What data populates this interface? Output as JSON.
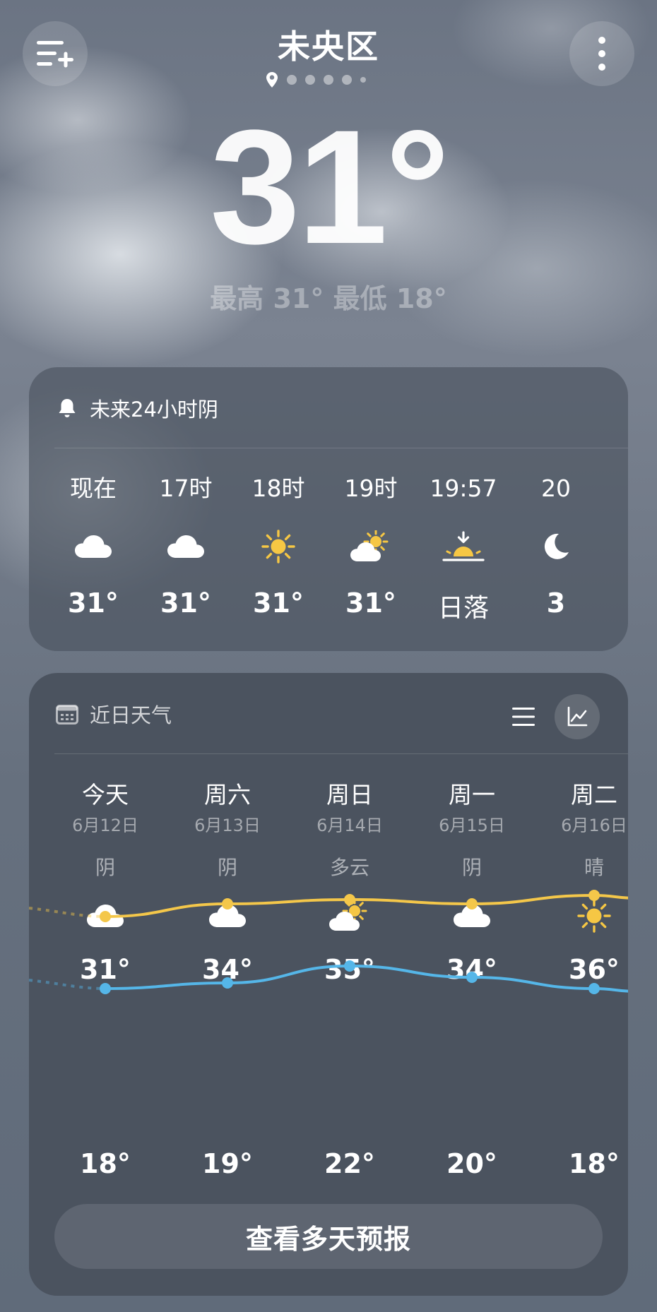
{
  "location": "未央区",
  "current": {
    "temperature": "31°",
    "hilo": "最高 31° 最低 18°"
  },
  "page_indicator": {
    "count": 6,
    "active": 0
  },
  "hourly": {
    "summary": "未来24小时阴",
    "items": [
      {
        "label": "现在",
        "icon": "cloud-icon",
        "value": "31°"
      },
      {
        "label": "17时",
        "icon": "cloud-icon",
        "value": "31°"
      },
      {
        "label": "18时",
        "icon": "sun-icon",
        "value": "31°"
      },
      {
        "label": "19时",
        "icon": "partly-cloudy-icon",
        "value": "31°"
      },
      {
        "label": "19:57",
        "icon": "sunset-icon",
        "value": "日落"
      },
      {
        "label": "20",
        "icon": "moon-icon",
        "value": "3"
      }
    ]
  },
  "daily": {
    "title": "近日天气",
    "days": [
      {
        "name": "今天",
        "date": "6月12日",
        "condition": "阴",
        "icon": "cloud-icon",
        "high": "31°",
        "low": "18°"
      },
      {
        "name": "周六",
        "date": "6月13日",
        "condition": "阴",
        "icon": "cloud-icon",
        "high": "34°",
        "low": "19°"
      },
      {
        "name": "周日",
        "date": "6月14日",
        "condition": "多云",
        "icon": "partly-cloudy-icon",
        "high": "35°",
        "low": "22°"
      },
      {
        "name": "周一",
        "date": "6月15日",
        "condition": "阴",
        "icon": "cloud-icon",
        "high": "34°",
        "low": "20°"
      },
      {
        "name": "周二",
        "date": "6月16日",
        "condition": "晴",
        "icon": "sun-icon",
        "high": "36°",
        "low": "18°"
      }
    ],
    "forecast_button": "查看多天预报"
  },
  "colors": {
    "high_line": "#f4c74a",
    "low_line": "#55b6e8",
    "sun": "#f6c744"
  }
}
